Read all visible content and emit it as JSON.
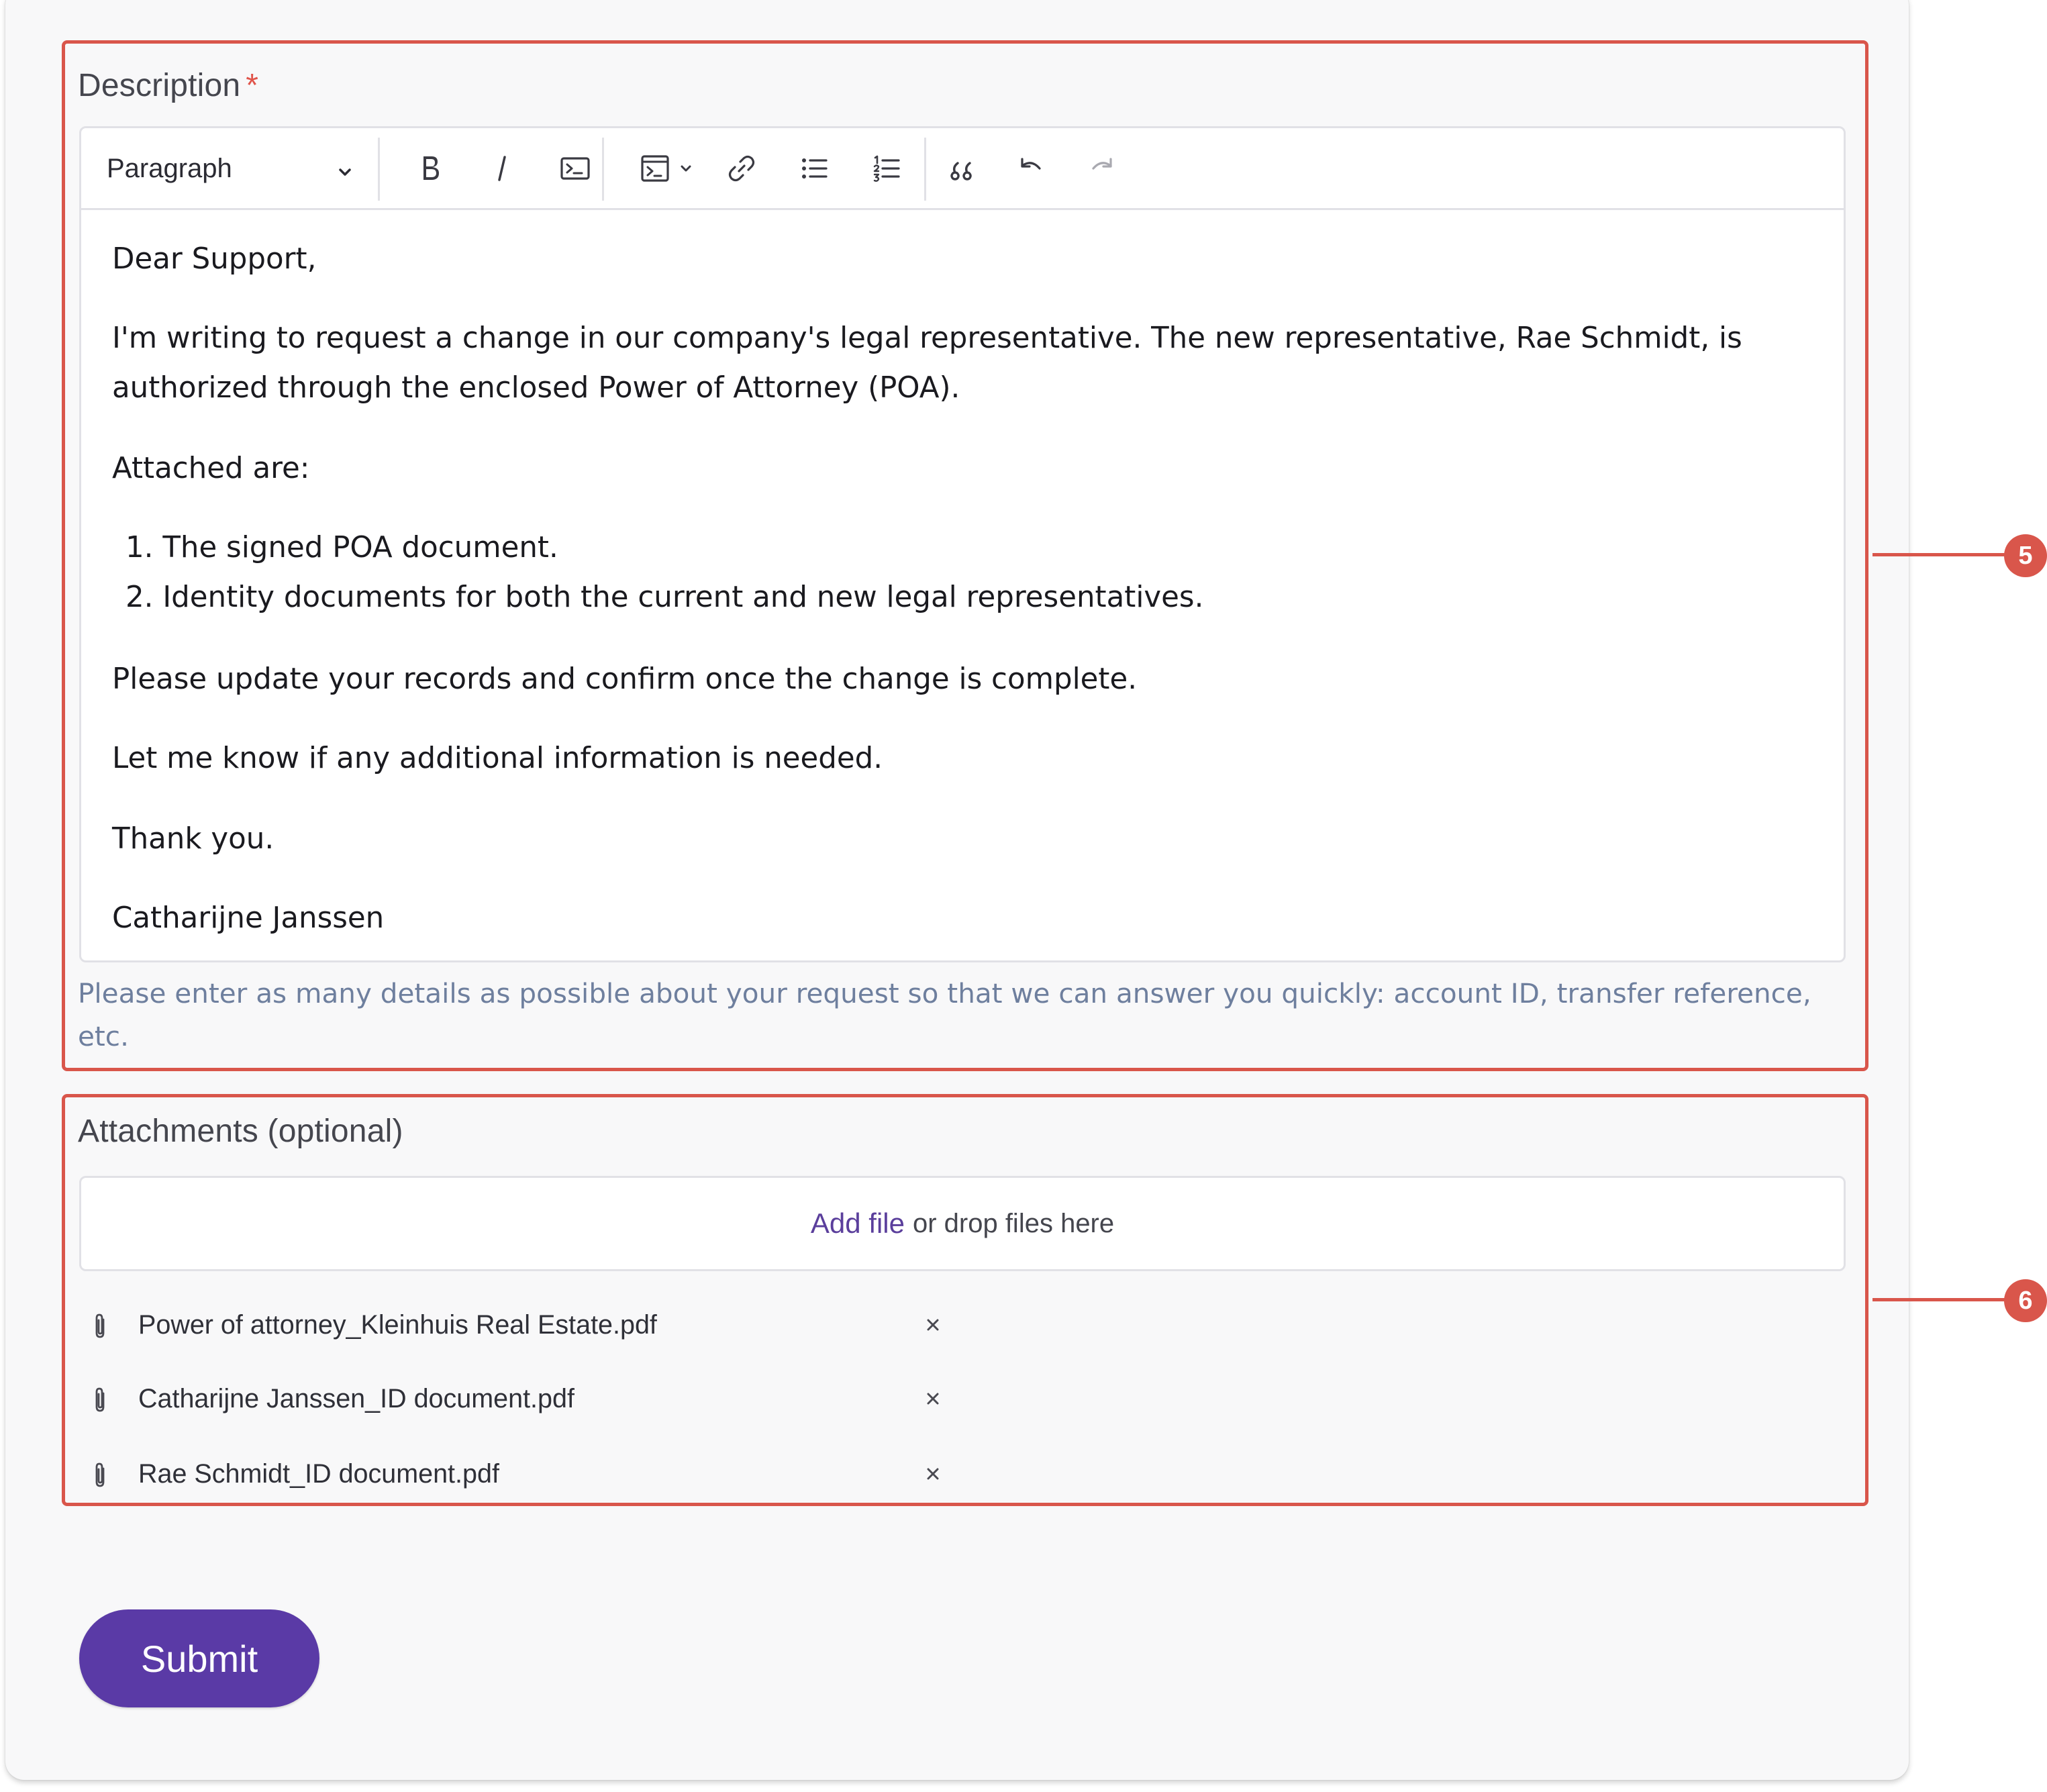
{
  "description": {
    "label": "Description",
    "required_marker": "*",
    "toolbar": {
      "block_format": "Paragraph",
      "icons": [
        "bold-icon",
        "italic-icon",
        "code-icon",
        "code-block-icon",
        "link-icon",
        "bulleted-list-icon",
        "numbered-list-icon",
        "blockquote-icon",
        "undo-icon",
        "redo-icon"
      ]
    },
    "body": {
      "greeting": "Dear Support,",
      "paragraph_1_line_1": "I'm writing to request a change in our company's legal representative. The new representative, Rae Schmidt, is",
      "paragraph_1_line_2": "authorized through the enclosed Power of Attorney (POA).",
      "attached_intro": "Attached are:",
      "list": [
        "1. The signed POA document.",
        "2. Identity documents for both the current and new legal representatives."
      ],
      "paragraph_2": "Please update your records and confirm once the change is complete.",
      "paragraph_3": "Let me know if any additional information is needed.",
      "closing": "Thank you.",
      "signature": "Catharijne Janssen"
    },
    "helper_text": "Please enter as many details as possible about your request so that we can answer you quickly: account ID, transfer reference, etc."
  },
  "attachments": {
    "label": "Attachments (optional)",
    "add_file": "Add file",
    "drop_text": "or drop files here",
    "files": [
      "Power of attorney_Kleinhuis Real Estate.pdf",
      "Catharijne Janssen_ID document.pdf",
      "Rae Schmidt_ID document.pdf"
    ],
    "remove_symbol": "×"
  },
  "submit_label": "Submit",
  "callouts": [
    "5",
    "6"
  ],
  "colors": {
    "highlight": "#d9564b",
    "primary": "#5a3aa6",
    "link": "#5b3f9c",
    "helper": "#6e7f9e"
  }
}
